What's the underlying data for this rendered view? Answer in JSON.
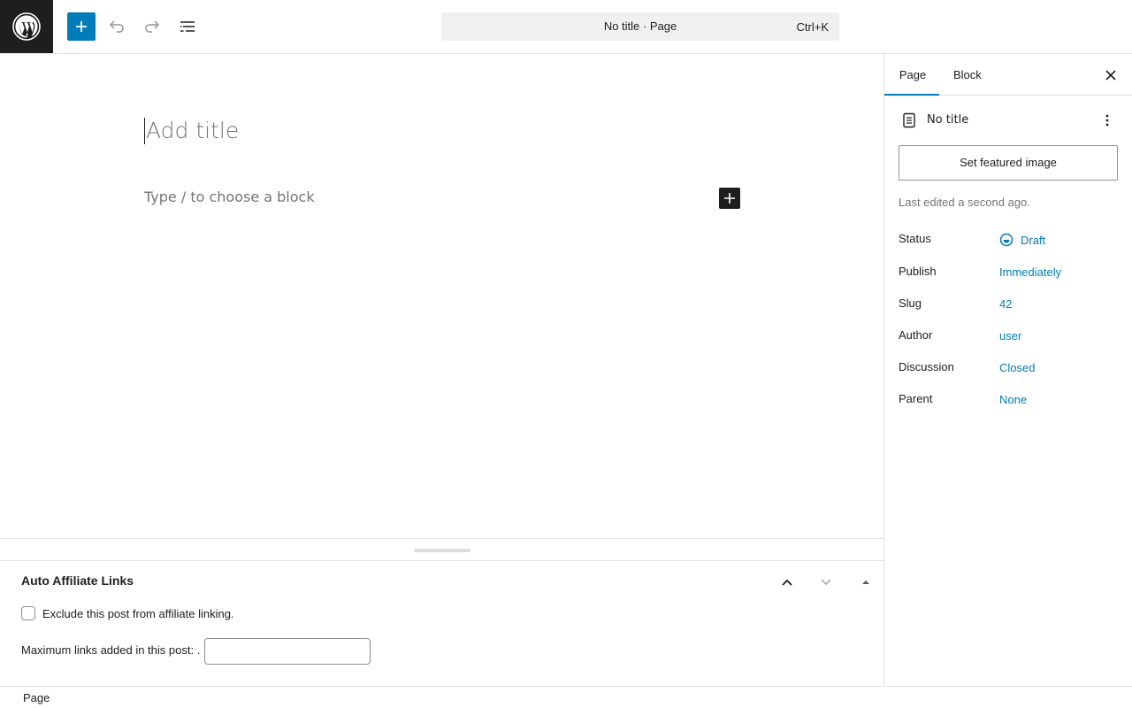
{
  "header": {
    "command_bar_title": "No title · Page",
    "command_bar_shortcut": "Ctrl+K"
  },
  "editor": {
    "title_placeholder": "Add title",
    "block_placeholder": "Type / to choose a block"
  },
  "metabox": {
    "title": "Auto Affiliate Links",
    "exclude_label": "Exclude this post from affiliate linking.",
    "exclude_checked": false,
    "max_links_label": "Maximum links added in this post: .",
    "max_links_value": ""
  },
  "footer": {
    "breadcrumb": "Page"
  },
  "sidebar": {
    "tabs": [
      {
        "label": "Page",
        "active": true
      },
      {
        "label": "Block",
        "active": false
      }
    ],
    "doc_title": "No title",
    "featured_image_button": "Set featured image",
    "last_edited": "Last edited a second ago.",
    "rows": [
      {
        "label": "Status",
        "value": "Draft"
      },
      {
        "label": "Publish",
        "value": "Immediately"
      },
      {
        "label": "Slug",
        "value": "42"
      },
      {
        "label": "Author",
        "value": "user"
      },
      {
        "label": "Discussion",
        "value": "Closed"
      },
      {
        "label": "Parent",
        "value": "None"
      }
    ]
  },
  "colors": {
    "accent": "#007cba",
    "dark": "#1e1e1e"
  },
  "icons": [
    "wordpress-icon",
    "plus-icon",
    "undo-icon",
    "redo-icon",
    "list-view-icon",
    "close-icon",
    "page-icon",
    "more-vertical-icon",
    "draft-status-icon",
    "chevron-up-icon",
    "chevron-down-icon",
    "caret-up-icon"
  ]
}
